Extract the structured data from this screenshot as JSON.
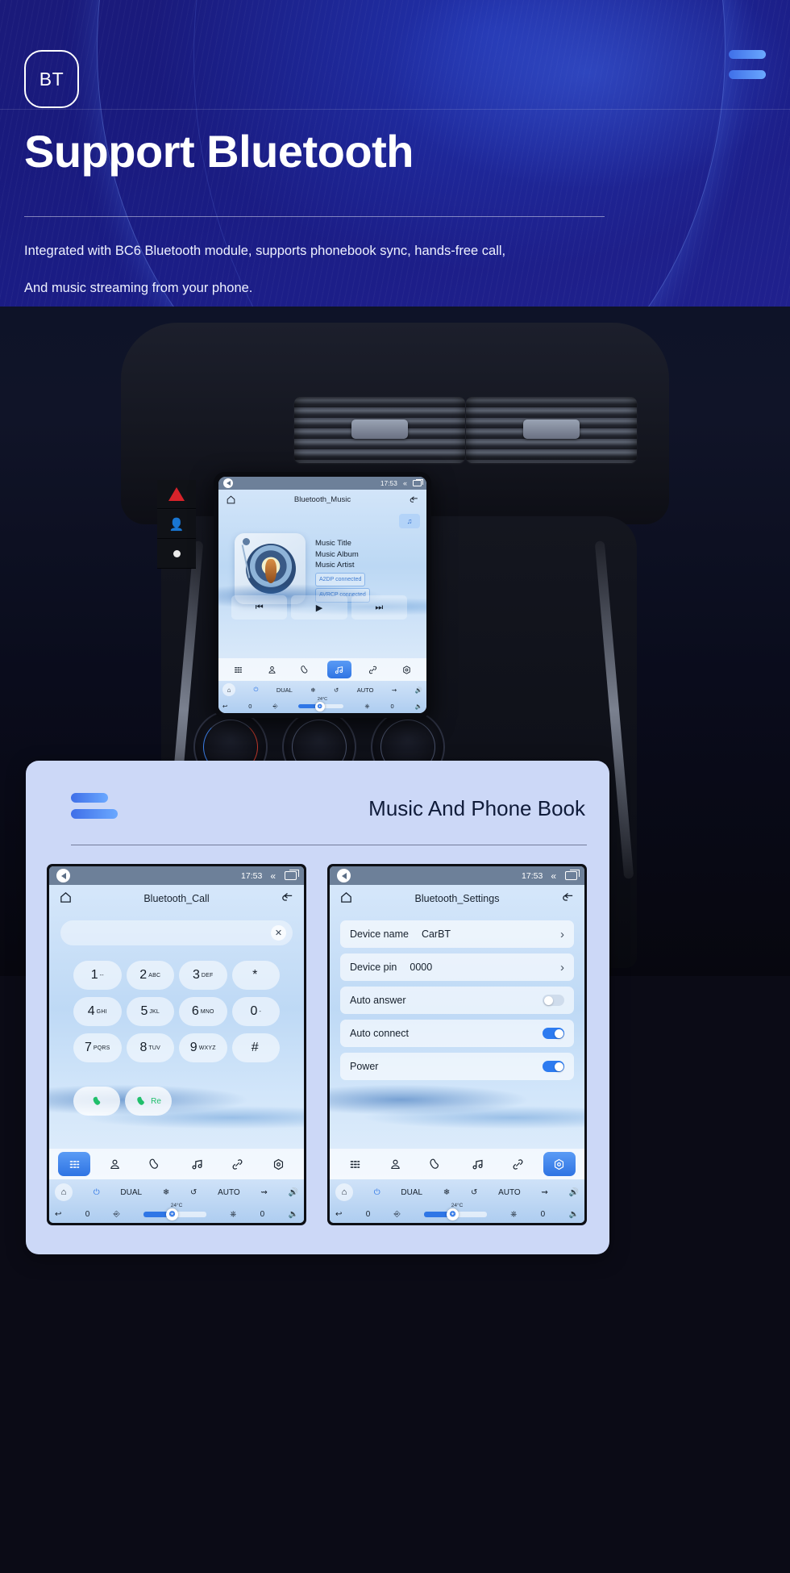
{
  "hero": {
    "badge": "BT",
    "title": "Support Bluetooth",
    "desc_line1": "Integrated with BC6 Bluetooth module, supports phonebook sync, hands-free call,",
    "desc_line2": "And music streaming from your phone.",
    "menu_icon": "hamburger-icon",
    "accent": "#5b93f5",
    "background": "#1b1d86"
  },
  "headunit": {
    "statusbar": {
      "time": "17:53",
      "back_icon": "back-triangle-icon",
      "chevron_icon": "«",
      "recents_icon": "recents-icon"
    },
    "appbar": {
      "home_icon": "home-icon",
      "title": "Bluetooth_Music",
      "back_icon": "back-curve-icon"
    },
    "chip_icon": "music-note-icon",
    "track": {
      "title": "Music Title",
      "album": "Music Album",
      "artist": "Music Artist",
      "a2dp": "A2DP  connected",
      "avrcp": "AVRCP connected"
    },
    "transport": {
      "prev": "⏮",
      "play": "▶",
      "next": "⏭"
    },
    "dock": [
      {
        "name": "apps-grid-icon",
        "glyph": "☷",
        "active": false
      },
      {
        "name": "contacts-icon",
        "glyph": "●",
        "active": false
      },
      {
        "name": "phone-icon",
        "glyph": "✆",
        "active": false
      },
      {
        "name": "music-icon",
        "glyph": "♫",
        "active": true
      },
      {
        "name": "link-icon",
        "glyph": "⛓",
        "active": false
      },
      {
        "name": "settings-icon",
        "glyph": "⬡",
        "active": false
      }
    ],
    "climate": {
      "power": "power-icon",
      "dual": "DUAL",
      "ac": "snowflake-icon",
      "recirc": "recirculate-icon",
      "auto": "AUTO",
      "defrost": "defrost-icon",
      "vol_up": "volume-up-icon",
      "vol_down": "volume-down-icon",
      "temp": "24°C",
      "left_value": "0",
      "right_value": "0",
      "seat_icon": "seat-icon",
      "seat_heat_icon": "seat-heat-icon",
      "back_icon": "back-arrow-icon",
      "home_icon": "home-icon"
    }
  },
  "card": {
    "title": "Music And Phone Book"
  },
  "call_screen": {
    "statusbar": {
      "time": "17:53"
    },
    "appbar": {
      "title": "Bluetooth_Call"
    },
    "input_value": "",
    "clear_icon": "close-icon",
    "keys": [
      {
        "num": "1",
        "sub": "--"
      },
      {
        "num": "2",
        "sub": "ABC"
      },
      {
        "num": "3",
        "sub": "DEF"
      },
      {
        "num": "*",
        "sub": ""
      },
      {
        "num": "4",
        "sub": "GHI"
      },
      {
        "num": "5",
        "sub": "JKL"
      },
      {
        "num": "6",
        "sub": "MNO"
      },
      {
        "num": "0",
        "sub": "-"
      },
      {
        "num": "7",
        "sub": "PQRS"
      },
      {
        "num": "8",
        "sub": "TUV"
      },
      {
        "num": "9",
        "sub": "WXYZ"
      },
      {
        "num": "#",
        "sub": ""
      }
    ],
    "call_button": "✆",
    "redial_button_label": "Re",
    "dock_active": "apps-grid-icon"
  },
  "settings_screen": {
    "statusbar": {
      "time": "17:53"
    },
    "appbar": {
      "title": "Bluetooth_Settings"
    },
    "rows": [
      {
        "label": "Device name",
        "value": "CarBT",
        "control": "chevron"
      },
      {
        "label": "Device pin",
        "value": "0000",
        "control": "chevron"
      },
      {
        "label": "Auto answer",
        "value": "",
        "control": "toggle",
        "on": false
      },
      {
        "label": "Auto connect",
        "value": "",
        "control": "toggle",
        "on": true
      },
      {
        "label": "Power",
        "value": "",
        "control": "toggle",
        "on": true
      }
    ],
    "dock_active": "settings-icon"
  }
}
